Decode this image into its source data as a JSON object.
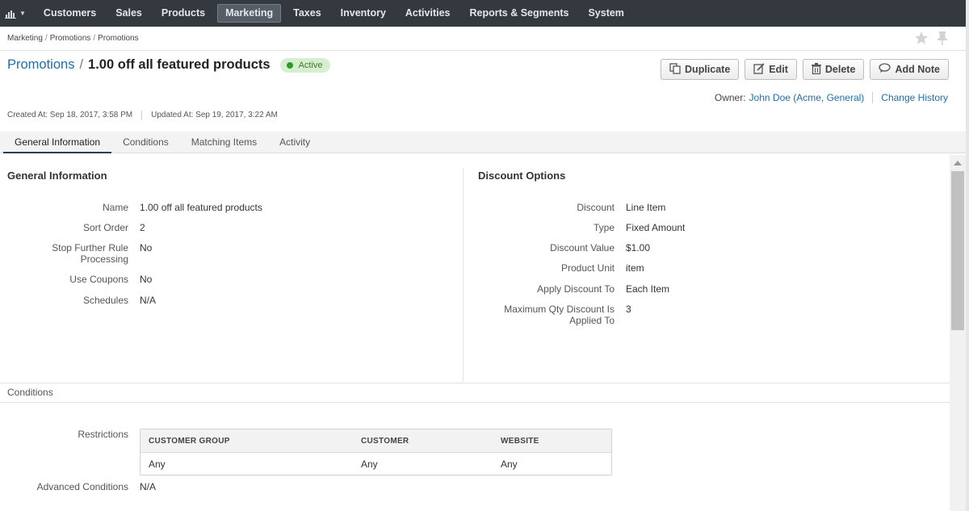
{
  "nav": {
    "items": [
      "Customers",
      "Sales",
      "Products",
      "Marketing",
      "Taxes",
      "Inventory",
      "Activities",
      "Reports & Segments",
      "System"
    ],
    "active_item": "Marketing"
  },
  "breadcrumb": [
    "Marketing",
    "Promotions",
    "Promotions"
  ],
  "page": {
    "section_link": "Promotions",
    "title": "1.00 off all featured products",
    "status": "Active"
  },
  "actions": {
    "duplicate": "Duplicate",
    "edit": "Edit",
    "delete": "Delete",
    "add_note": "Add Note"
  },
  "owner": {
    "label": "Owner:",
    "value": "John Doe (Acme, General)",
    "change_history": "Change History"
  },
  "meta": {
    "created": "Created At: Sep 18, 2017, 3:58 PM",
    "updated": "Updated At: Sep 19, 2017, 3:22 AM"
  },
  "tabs": [
    "General Information",
    "Conditions",
    "Matching Items",
    "Activity"
  ],
  "general": {
    "title": "General Information",
    "fields": [
      {
        "label": "Name",
        "value": "1.00 off all featured products"
      },
      {
        "label": "Sort Order",
        "value": "2"
      },
      {
        "label": "Stop Further Rule Processing",
        "value": "No"
      },
      {
        "label": "Use Coupons",
        "value": "No"
      },
      {
        "label": "Schedules",
        "value": "N/A"
      }
    ]
  },
  "discount": {
    "title": "Discount Options",
    "fields": [
      {
        "label": "Discount",
        "value": "Line Item"
      },
      {
        "label": "Type",
        "value": "Fixed Amount"
      },
      {
        "label": "Discount Value",
        "value": "$1.00"
      },
      {
        "label": "Product Unit",
        "value": "item"
      },
      {
        "label": "Apply Discount To",
        "value": "Each Item"
      },
      {
        "label": "Maximum Qty Discount Is Applied To",
        "value": "3"
      }
    ]
  },
  "conditions": {
    "title": "Conditions",
    "restrictions_label": "Restrictions",
    "columns": [
      "CUSTOMER GROUP",
      "CUSTOMER",
      "WEBSITE"
    ],
    "rows": [
      [
        "Any",
        "Any",
        "Any"
      ]
    ],
    "advanced_label": "Advanced Conditions",
    "advanced_value": "N/A"
  },
  "colors": {
    "nav_bg": "#33393f",
    "link": "#1f6fab",
    "status_bg": "#d8eed0",
    "status_dot": "#2f9a2a"
  }
}
